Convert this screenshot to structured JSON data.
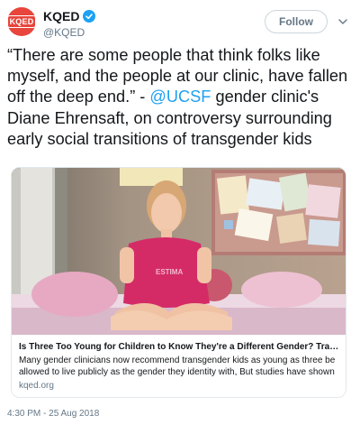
{
  "account": {
    "avatar_text": "KQED",
    "name": "KQED",
    "handle": "@KQED",
    "follow_label": "Follow",
    "brand_color": "#e8453c",
    "verified_color": "#1da1f2"
  },
  "tweet": {
    "text_before": "“There are some people that think folks like myself, and the people at our clinic, have fallen off the deep end.” - ",
    "mention": "@UCSF",
    "text_after": " gender clinic's Diane Ehrensaft, on controversy surrounding early social transitions of transgender kids",
    "timestamp": "4:30 PM - 25 Aug 2018"
  },
  "card": {
    "title": "Is Three Too Young for Children to Know They're a Different Gender? Transge...",
    "description": "Many gender clinicians now recommend transgender kids as young as three be allowed to live publicly as the gender they identity with, But studies have shown",
    "domain": "kqed.org",
    "shirt_text": "ESTIMA"
  },
  "icons": {
    "verified": "verified-badge-icon",
    "chevron": "chevron-down-icon"
  }
}
